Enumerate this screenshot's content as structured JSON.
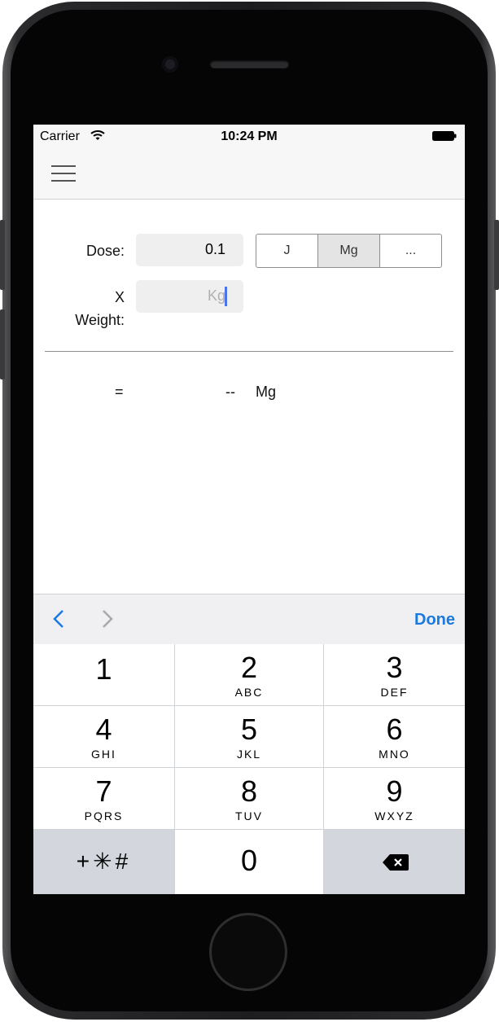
{
  "status_bar": {
    "carrier": "Carrier",
    "time": "10:24 PM"
  },
  "form": {
    "dose_label": "Dose:",
    "dose_value": "0.1",
    "unit_options": [
      "J",
      "Mg",
      "..."
    ],
    "unit_selected": "Mg",
    "weight_label_line1": "X",
    "weight_label_line2": "Weight:",
    "weight_placeholder": "Kg"
  },
  "result": {
    "equals": "=",
    "value": "--",
    "unit": "Mg"
  },
  "keyboard": {
    "done_label": "Done",
    "keys": [
      {
        "num": "1",
        "letters": ""
      },
      {
        "num": "2",
        "letters": "ABC"
      },
      {
        "num": "3",
        "letters": "DEF"
      },
      {
        "num": "4",
        "letters": "GHI"
      },
      {
        "num": "5",
        "letters": "JKL"
      },
      {
        "num": "6",
        "letters": "MNO"
      },
      {
        "num": "7",
        "letters": "PQRS"
      },
      {
        "num": "8",
        "letters": "TUV"
      },
      {
        "num": "9",
        "letters": "WXYZ"
      },
      {
        "num": "0",
        "letters": ""
      }
    ],
    "symbols_label": "+✳#",
    "accent_color": "#1a7ae0"
  }
}
